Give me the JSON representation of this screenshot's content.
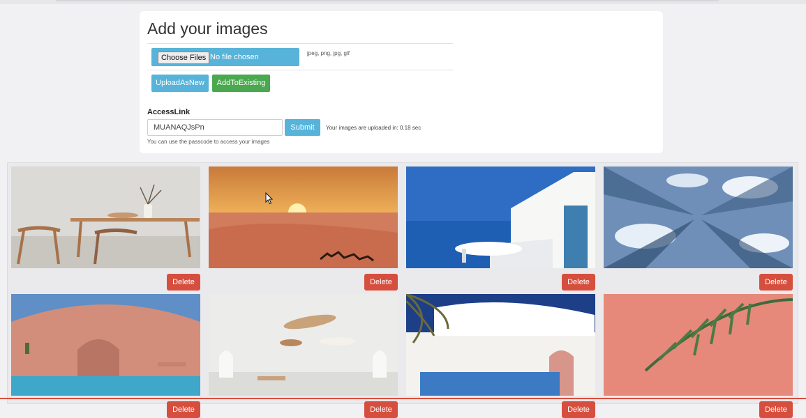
{
  "upload": {
    "title": "Add your images",
    "choose_button": "Choose Files",
    "no_file": "No file chosen",
    "formats_hint": "jpeg, png, jpg, gif",
    "upload_new_label": "UploadAsNew",
    "add_existing_label": "AddToExisting"
  },
  "access": {
    "label": "AccessLink",
    "value": "MUANAQJsPn",
    "submit_label": "Submit",
    "upload_time": "Your images are uploaded in: 0.18 sec",
    "help": "You can use the passcode to access your images"
  },
  "gallery": {
    "delete_label": "Delete",
    "images": [
      {
        "subject": "dining-table-chairs-vase",
        "colors": [
          "#d8d5d0",
          "#b8845a"
        ]
      },
      {
        "subject": "desert-sunset-camels",
        "colors": [
          "#d88a4e",
          "#c96c4e"
        ]
      },
      {
        "subject": "white-building-blue-sea",
        "colors": [
          "#2f6cc4",
          "#ffffff"
        ]
      },
      {
        "subject": "glass-skyscrapers-sky",
        "colors": [
          "#5e7fa8",
          "#e6eef8"
        ]
      },
      {
        "subject": "pink-arch-pool",
        "colors": [
          "#d28e7a",
          "#3fa7c9"
        ]
      },
      {
        "subject": "white-room-floating-discs",
        "colors": [
          "#ececea",
          "#c9a27a"
        ]
      },
      {
        "subject": "palm-white-house-pool",
        "colors": [
          "#1d3f88",
          "#f4f2ef"
        ]
      },
      {
        "subject": "palm-leaf-pink-wall",
        "colors": [
          "#e6897a",
          "#3f6a3a"
        ]
      }
    ]
  },
  "colors": {
    "primary": "#57b3d9",
    "success": "#4aa84e",
    "danger": "#d64f3e",
    "background": "#f1f1f4"
  }
}
